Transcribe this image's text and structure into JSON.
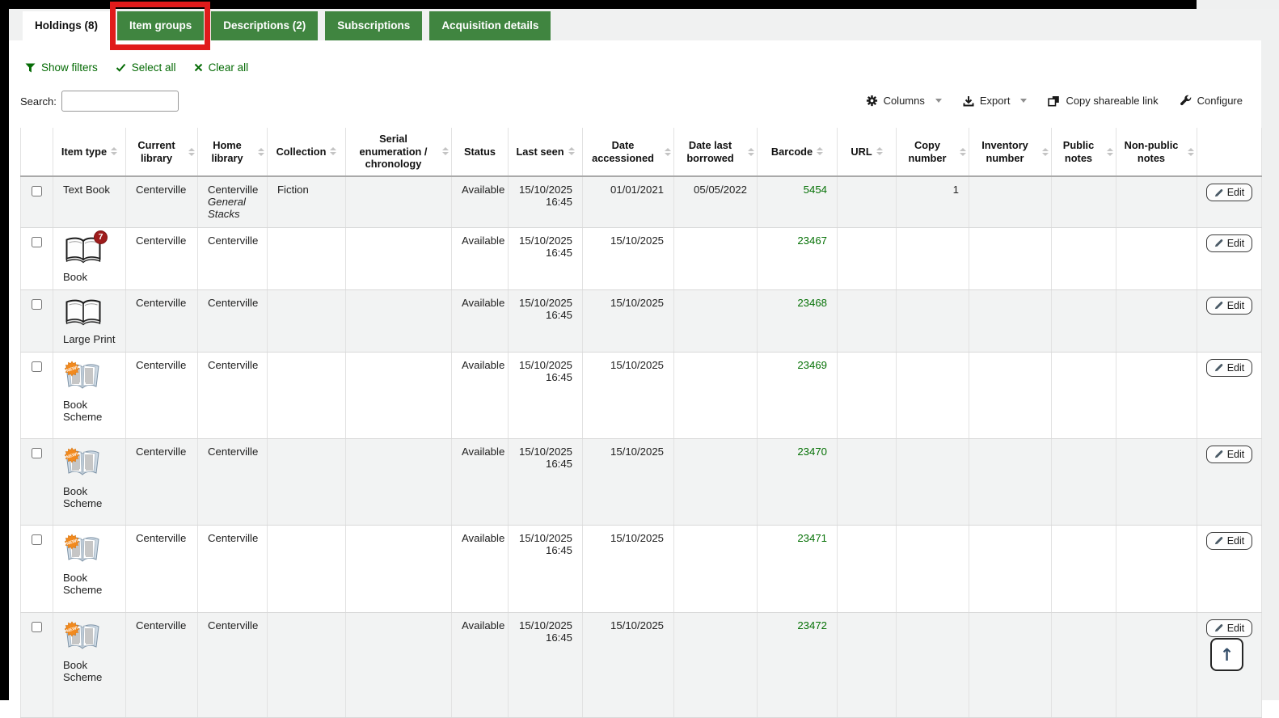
{
  "tabs": {
    "items": [
      {
        "label": "Holdings (8)",
        "active": true,
        "annotated": false
      },
      {
        "label": "Item groups",
        "active": false,
        "annotated": true
      },
      {
        "label": "Descriptions (2)",
        "active": false,
        "annotated": false
      },
      {
        "label": "Subscriptions",
        "active": false,
        "annotated": false
      },
      {
        "label": "Acquisition details",
        "active": false,
        "annotated": false
      }
    ]
  },
  "actions": {
    "show_filters": "Show filters",
    "select_all": "Select all",
    "clear_all": "Clear all"
  },
  "search": {
    "label": "Search:",
    "value": "",
    "placeholder": ""
  },
  "toolbar": {
    "columns": "Columns",
    "export": "Export",
    "copy_shareable_link": "Copy shareable link",
    "configure": "Configure"
  },
  "labels": {
    "edit": "Edit",
    "back_to_top_icon": "↑"
  },
  "icons": [
    "funnel-icon",
    "check-icon",
    "x-icon",
    "gear-icon",
    "download-icon",
    "copy-icon",
    "wrench-icon",
    "pencil-icon",
    "book-icon",
    "book-new-icon",
    "up-arrow-icon"
  ],
  "colors": {
    "tab_green": "#408540",
    "link_green": "#056b05",
    "barcode_green": "#067106",
    "annotation_red": "#e01b1b",
    "row_alt_gray": "#f2f3f3",
    "badge_red": "#9e1c1c",
    "new_badge_orange": "#f28a1e",
    "topbar_black": "#000000"
  },
  "table": {
    "headers": [
      {
        "label": "Item type",
        "sortable": true
      },
      {
        "label": "Current library",
        "sortable": true
      },
      {
        "label": "Home library",
        "sortable": true
      },
      {
        "label": "Collection",
        "sortable": true
      },
      {
        "label": "Serial enumeration / chronology",
        "sortable": true
      },
      {
        "label": "Status",
        "sortable": false
      },
      {
        "label": "Last seen",
        "sortable": true
      },
      {
        "label": "Date accessioned",
        "sortable": true
      },
      {
        "label": "Date last borrowed",
        "sortable": true
      },
      {
        "label": "Barcode",
        "sortable": true
      },
      {
        "label": "URL",
        "sortable": true
      },
      {
        "label": "Copy number",
        "sortable": true
      },
      {
        "label": "Inventory number",
        "sortable": true
      },
      {
        "label": "Public notes",
        "sortable": true
      },
      {
        "label": "Non-public notes",
        "sortable": true
      }
    ],
    "rows": [
      {
        "item_type": "Text Book",
        "icon": "none",
        "badge": "",
        "current_library": "Centerville",
        "home_library": "Centerville",
        "home_library_detail": "General Stacks",
        "collection": "Fiction",
        "serial": "",
        "status": "Available",
        "last_seen_date": "15/10/2025",
        "last_seen_time": "16:45",
        "date_accessioned": "01/01/2021",
        "date_last_borrowed": "05/05/2022",
        "barcode": "5454",
        "url": "",
        "copy_number": "1",
        "inventory_number": "",
        "public_notes": "",
        "non_public_notes": ""
      },
      {
        "item_type": "Book",
        "icon": "book-badge",
        "badge": "7",
        "current_library": "Centerville",
        "home_library": "Centerville",
        "home_library_detail": "",
        "collection": "",
        "serial": "",
        "status": "Available",
        "last_seen_date": "15/10/2025",
        "last_seen_time": "16:45",
        "date_accessioned": "15/10/2025",
        "date_last_borrowed": "",
        "barcode": "23467",
        "url": "",
        "copy_number": "",
        "inventory_number": "",
        "public_notes": "",
        "non_public_notes": ""
      },
      {
        "item_type": "Large Print",
        "icon": "book",
        "badge": "",
        "current_library": "Centerville",
        "home_library": "Centerville",
        "home_library_detail": "",
        "collection": "",
        "serial": "",
        "status": "Available",
        "last_seen_date": "15/10/2025",
        "last_seen_time": "16:45",
        "date_accessioned": "15/10/2025",
        "date_last_borrowed": "",
        "barcode": "23468",
        "url": "",
        "copy_number": "",
        "inventory_number": "",
        "public_notes": "",
        "non_public_notes": ""
      },
      {
        "item_type": "Book Scheme",
        "icon": "book-new",
        "badge": "",
        "current_library": "Centerville",
        "home_library": "Centerville",
        "home_library_detail": "",
        "collection": "",
        "serial": "",
        "status": "Available",
        "last_seen_date": "15/10/2025",
        "last_seen_time": "16:45",
        "date_accessioned": "15/10/2025",
        "date_last_borrowed": "",
        "barcode": "23469",
        "url": "",
        "copy_number": "",
        "inventory_number": "",
        "public_notes": "",
        "non_public_notes": ""
      },
      {
        "item_type": "Book Scheme",
        "icon": "book-new",
        "badge": "",
        "current_library": "Centerville",
        "home_library": "Centerville",
        "home_library_detail": "",
        "collection": "",
        "serial": "",
        "status": "Available",
        "last_seen_date": "15/10/2025",
        "last_seen_time": "16:45",
        "date_accessioned": "15/10/2025",
        "date_last_borrowed": "",
        "barcode": "23470",
        "url": "",
        "copy_number": "",
        "inventory_number": "",
        "public_notes": "",
        "non_public_notes": ""
      },
      {
        "item_type": "Book Scheme",
        "icon": "book-new",
        "badge": "",
        "current_library": "Centerville",
        "home_library": "Centerville",
        "home_library_detail": "",
        "collection": "",
        "serial": "",
        "status": "Available",
        "last_seen_date": "15/10/2025",
        "last_seen_time": "16:45",
        "date_accessioned": "15/10/2025",
        "date_last_borrowed": "",
        "barcode": "23471",
        "url": "",
        "copy_number": "",
        "inventory_number": "",
        "public_notes": "",
        "non_public_notes": ""
      },
      {
        "item_type": "Book Scheme",
        "icon": "book-new",
        "badge": "",
        "current_library": "Centerville",
        "home_library": "Centerville",
        "home_library_detail": "",
        "collection": "",
        "serial": "",
        "status": "Available",
        "last_seen_date": "15/10/2025",
        "last_seen_time": "16:45",
        "date_accessioned": "15/10/2025",
        "date_last_borrowed": "",
        "barcode": "23472",
        "url": "",
        "copy_number": "",
        "inventory_number": "",
        "public_notes": "",
        "non_public_notes": ""
      }
    ]
  }
}
